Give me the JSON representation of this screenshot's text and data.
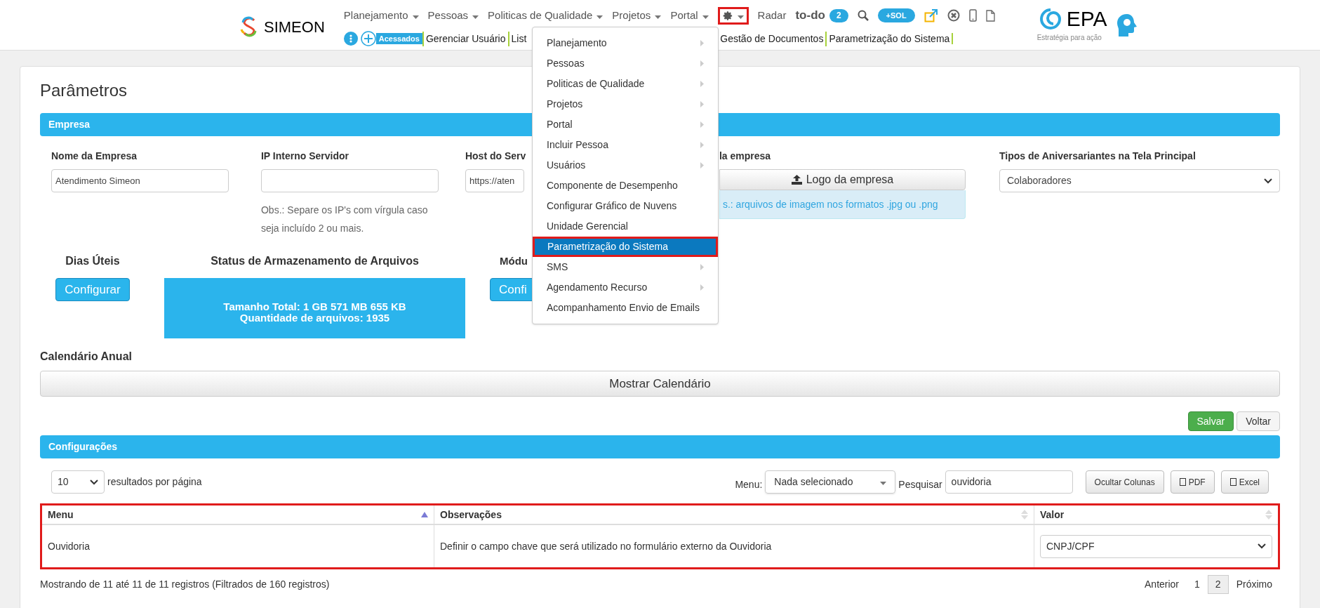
{
  "header": {
    "logo": "SIMEON",
    "nav": [
      {
        "kind": "menu",
        "label": "Planejamento"
      },
      {
        "kind": "menu",
        "label": "Pessoas"
      },
      {
        "kind": "menu",
        "label": "Politicas de Qualidade"
      },
      {
        "kind": "menu",
        "label": "Projetos"
      },
      {
        "kind": "menu",
        "label": "Portal"
      },
      {
        "kind": "gear",
        "highlighted": true
      },
      {
        "kind": "link",
        "label": "Radar"
      },
      {
        "kind": "todo",
        "label": "to-do",
        "badge": "2"
      },
      {
        "kind": "search"
      },
      {
        "kind": "pill",
        "label": "+SOL"
      },
      {
        "kind": "external"
      },
      {
        "kind": "close"
      },
      {
        "kind": "phone"
      },
      {
        "kind": "file"
      }
    ],
    "quick": {
      "badge": "Acessados",
      "links": [
        "Gerenciar Usuário",
        "List",
        "Gestão de Documentos",
        "Parametrização do Sistema"
      ]
    },
    "brand": {
      "name": "EPA",
      "tagline": "Estratégia para ação"
    }
  },
  "dropdown": [
    {
      "label": "Planejamento",
      "submenu": true,
      "selected": false
    },
    {
      "label": "Pessoas",
      "submenu": true,
      "selected": false
    },
    {
      "label": "Politicas de Qualidade",
      "submenu": true,
      "selected": false
    },
    {
      "label": "Projetos",
      "submenu": true,
      "selected": false
    },
    {
      "label": "Portal",
      "submenu": true,
      "selected": false
    },
    {
      "label": "Incluir Pessoa",
      "submenu": true,
      "selected": false
    },
    {
      "label": "Usuários",
      "submenu": true,
      "selected": false
    },
    {
      "label": "Componente de Desempenho",
      "submenu": false,
      "selected": false
    },
    {
      "label": "Configurar Gráfico de Nuvens",
      "submenu": false,
      "selected": false
    },
    {
      "label": "Unidade Gerencial",
      "submenu": false,
      "selected": false
    },
    {
      "label": "Parametrização do Sistema",
      "submenu": false,
      "selected": true
    },
    {
      "label": "SMS",
      "submenu": true,
      "selected": false
    },
    {
      "label": "Agendamento Recurso",
      "submenu": true,
      "selected": false
    },
    {
      "label": "Acompanhamento Envio de Emails",
      "submenu": false,
      "selected": false
    }
  ],
  "page_title": "Parâmetros",
  "empresa": {
    "title": "Empresa",
    "fields": [
      {
        "kind": "input",
        "label": "Nome da Empresa",
        "value": "Atendimento Simeon"
      },
      {
        "kind": "input",
        "label": "IP Interno Servidor",
        "note": "Obs.: Separe os IP's com vírgula caso seja incluído 2 ou mais."
      },
      {
        "kind": "input",
        "label": "Host do Serv",
        "value": "https://aten"
      },
      {
        "kind": "upload",
        "label": "la empresa",
        "button": "Logo da empresa",
        "note": "s.: arquivos de imagem nos formatos .jpg ou .png"
      },
      {
        "kind": "select",
        "label": "Tipos de Aniversariantes na Tela Principal",
        "value": "Colaboradores"
      }
    ]
  },
  "widgets": [
    {
      "kind": "button",
      "title": "Dias Úteis",
      "button": "Configurar"
    },
    {
      "kind": "status",
      "title": "Status de Armazenamento de Arquivos",
      "lines": [
        "Tamanho Total: 1 GB 571 MB 655 KB",
        "Quantidade de arquivos: 1935"
      ]
    },
    {
      "kind": "partial",
      "title": "Módu",
      "button": "Confi"
    }
  ],
  "calendar": {
    "title": "Calendário Anual",
    "button": "Mostrar Calendário"
  },
  "actions": [
    {
      "label": "Salvar",
      "kind": "primary"
    },
    {
      "label": "Voltar",
      "kind": "default"
    }
  ],
  "config": {
    "title": "Configurações",
    "per_page": "10",
    "per_page_label": "resultados por página",
    "menu_label": "Menu:",
    "menu_value": "Nada selecionado",
    "search_label": "Pesquisar",
    "search_value": "ouvidoria",
    "buttons": [
      {
        "label": "Ocultar Colunas",
        "kind": "plain"
      },
      {
        "label": "PDF",
        "kind": "pdf"
      },
      {
        "label": "Excel",
        "kind": "excel"
      }
    ],
    "table": {
      "highlighted": true,
      "columns": [
        {
          "label": "Menu",
          "sorted": true
        },
        {
          "label": "Observações",
          "sorted": false
        },
        {
          "label": "Valor",
          "sorted": false
        }
      ],
      "rows": [
        {
          "menu": "Ouvidoria",
          "observacoes": "Definir o campo chave que será utilizado no formulário externo da Ouvidoria",
          "valor": "CNPJ/CPF"
        }
      ]
    },
    "info": "Mostrando de 11 até 11 de 11 registros (Filtrados de 160 registros)",
    "pagination": [
      {
        "label": "Anterior",
        "selected": false
      },
      {
        "label": "1",
        "selected": false
      },
      {
        "label": "2",
        "selected": true
      },
      {
        "label": "Próximo",
        "selected": false
      }
    ]
  }
}
